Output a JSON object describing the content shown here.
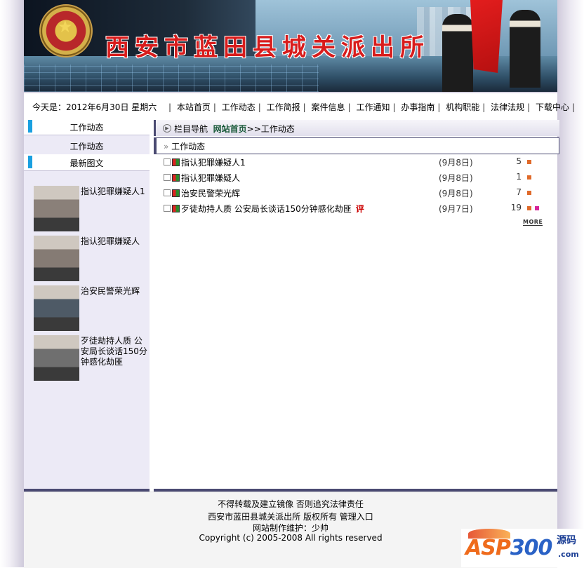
{
  "banner": {
    "site_title": "西安市蓝田县城关派出所"
  },
  "nav": {
    "date_text": "今天是：2012年6月30日 星期六",
    "items": [
      "本站首页",
      "工作动态",
      "工作简报",
      "案件信息",
      "工作通知",
      "办事指南",
      "机构职能",
      "法律法规",
      "下载中心"
    ]
  },
  "left": {
    "section1_title": "工作动态",
    "section1_item": "工作动态",
    "section2_title": "最新图文",
    "pics": [
      {
        "caption": "指认犯罪嫌疑人1",
        "thumb_color": "#8a8079"
      },
      {
        "caption": "指认犯罪嫌疑人",
        "thumb_color": "#857b74"
      },
      {
        "caption": "治安民警荣光辉",
        "thumb_color": "#4e5a66"
      },
      {
        "caption": "歹徒劫持人质 公安局长谈话150分钟感化劫匪",
        "thumb_color": "#6f6f6f"
      }
    ]
  },
  "breadcrumb": {
    "label": "栏目导航",
    "home": "网站首页",
    "sep": ">>",
    "current": "工作动态"
  },
  "section": {
    "title": "工作动态"
  },
  "news": [
    {
      "title": "指认犯罪嫌疑人1",
      "date": "(9月8日)",
      "hits": "5",
      "has_comment": false,
      "comment_label": ""
    },
    {
      "title": "指认犯罪嫌疑人",
      "date": "(9月8日)",
      "hits": "1",
      "has_comment": false,
      "comment_label": ""
    },
    {
      "title": "治安民警荣光辉",
      "date": "(9月8日)",
      "hits": "7",
      "has_comment": false,
      "comment_label": ""
    },
    {
      "title": "歹徒劫持人质 公安局长谈话150分钟感化劫匪",
      "date": "(9月7日)",
      "hits": "19",
      "has_comment": true,
      "comment_label": "评"
    }
  ],
  "more_label": "MORE",
  "footer": {
    "line1": "不得转载及建立镜像 否则追究法律责任",
    "line2": "西安市蓝田县城关派出所 版权所有  管理入口",
    "line3": "网站制作维护：少帅",
    "line4": "Copyright (c) 2005-2008 All rights reserved"
  },
  "watermark": {
    "asp": "ASP",
    "num": "300",
    "tag": "源码",
    "dom": ".com"
  }
}
